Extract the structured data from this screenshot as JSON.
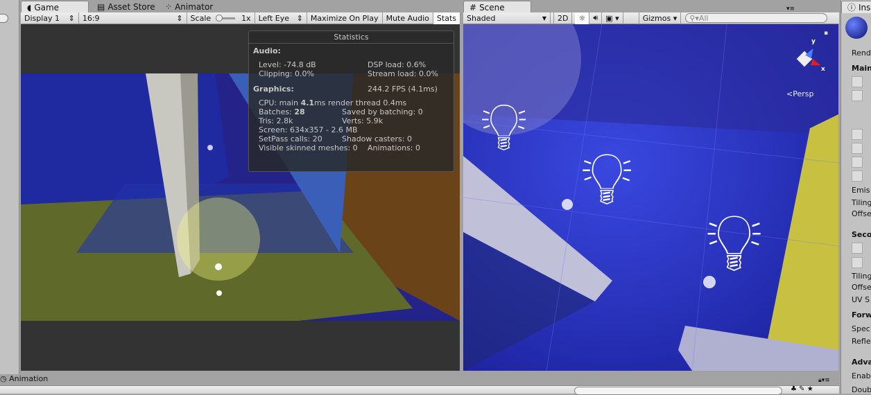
{
  "game": {
    "tab": "Game",
    "display": "Display 1",
    "aspect": "16:9",
    "scale_label": "Scale",
    "scale_value": "1x",
    "eye": "Left Eye",
    "maximize": "Maximize On Play",
    "mute": "Mute Audio",
    "stats": "Stats"
  },
  "other_tabs": {
    "asset_store": "Asset Store",
    "animator": "Animator"
  },
  "statistics": {
    "title": "Statistics",
    "audio_heading": "Audio:",
    "level": "Level: -74.8 dB",
    "dsp": "DSP load: 0.6%",
    "clipping": "Clipping: 0.0%",
    "stream": "Stream load: 0.0%",
    "graphics_heading": "Graphics:",
    "fps": "244.2 FPS (4.1ms)",
    "cpu_prefix": "CPU: main ",
    "cpu_main": "4.1",
    "cpu_suffix": "ms  render thread 0.4ms",
    "batches_prefix": "Batches: ",
    "batches": "28",
    "saved": "Saved by batching: 0",
    "tris": "Tris: 2.8k",
    "verts": "Verts: 5.9k",
    "screen": "Screen: 634x357 - 2.6 MB",
    "setpass": "SetPass calls: 20",
    "shadow": "Shadow casters: 0",
    "skinned": "Visible skinned meshes: 0",
    "animations": "Animations: 0"
  },
  "scene": {
    "tab": "Scene",
    "shading": "Shaded",
    "mode_2d": "2D",
    "gizmos": "Gizmos",
    "search_placeholder": "All",
    "persp": "Persp",
    "axis_y": "y",
    "axis_x": "x"
  },
  "inspector": {
    "tab": "Insp",
    "rows": [
      "Rend",
      "Main",
      "Emis",
      "Tiling",
      "Offse",
      "Seco",
      "Tiling",
      "Offse",
      "UV S",
      "Forw",
      "Spec",
      "Refle",
      "Adva",
      "Enab",
      "Doub"
    ]
  },
  "animation": {
    "tab": "Animation"
  }
}
